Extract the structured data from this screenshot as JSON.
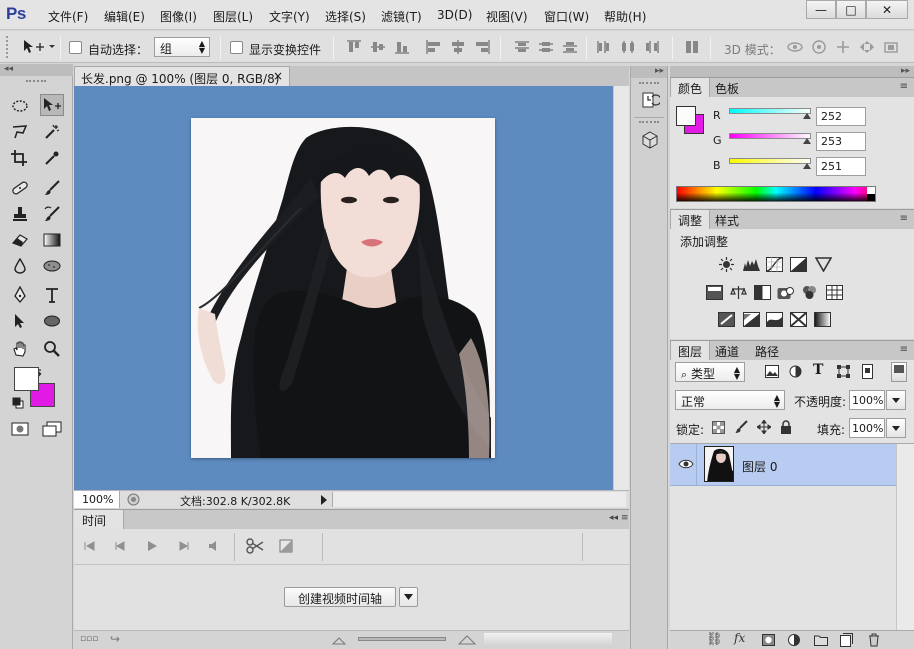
{
  "app": {
    "logo": "Ps"
  },
  "menu": [
    "文件(F)",
    "编辑(E)",
    "图像(I)",
    "图层(L)",
    "文字(Y)",
    "选择(S)",
    "滤镜(T)",
    "3D(D)",
    "视图(V)",
    "窗口(W)",
    "帮助(H)"
  ],
  "window_controls": {
    "minimize": "—",
    "maximize": "□",
    "close": "✕"
  },
  "options": {
    "auto_select_label": "自动选择：",
    "auto_select_value": "组",
    "show_transform_label": "显示变换控件",
    "mode_3d_label": "3D 模式："
  },
  "document": {
    "tab_title": "长发.png @ 100% (图层 0, RGB/8)",
    "tab_close": "×",
    "zoom": "100%",
    "doc_info": "文档:302.8 K/302.8K"
  },
  "timeline": {
    "tab": "时间轴",
    "create_button": "创建视频时间轴"
  },
  "color_panel": {
    "tabs": [
      "颜色",
      "色板"
    ],
    "channels": [
      {
        "label": "R",
        "value": "252"
      },
      {
        "label": "G",
        "value": "253"
      },
      {
        "label": "B",
        "value": "251"
      }
    ],
    "foreground": "#fcfdfb",
    "background": "#e21ae6"
  },
  "adjust_panel": {
    "tabs": [
      "调整",
      "样式"
    ],
    "title": "添加调整"
  },
  "layers_panel": {
    "tabs": [
      "图层",
      "通道",
      "路径"
    ],
    "filter_kind": "类型",
    "blend_mode": "正常",
    "opacity_label": "不透明度:",
    "opacity_value": "100%",
    "lock_label": "锁定:",
    "fill_label": "填充:",
    "fill_value": "100%",
    "layers": [
      {
        "name": "图层 0",
        "visible": true
      }
    ]
  },
  "colors": {
    "canvas_bg": "#5d8bc0",
    "selected_layer": "#b7ccf0",
    "fg_swatch": "#ffffff",
    "bg_swatch": "#e21ae6"
  }
}
